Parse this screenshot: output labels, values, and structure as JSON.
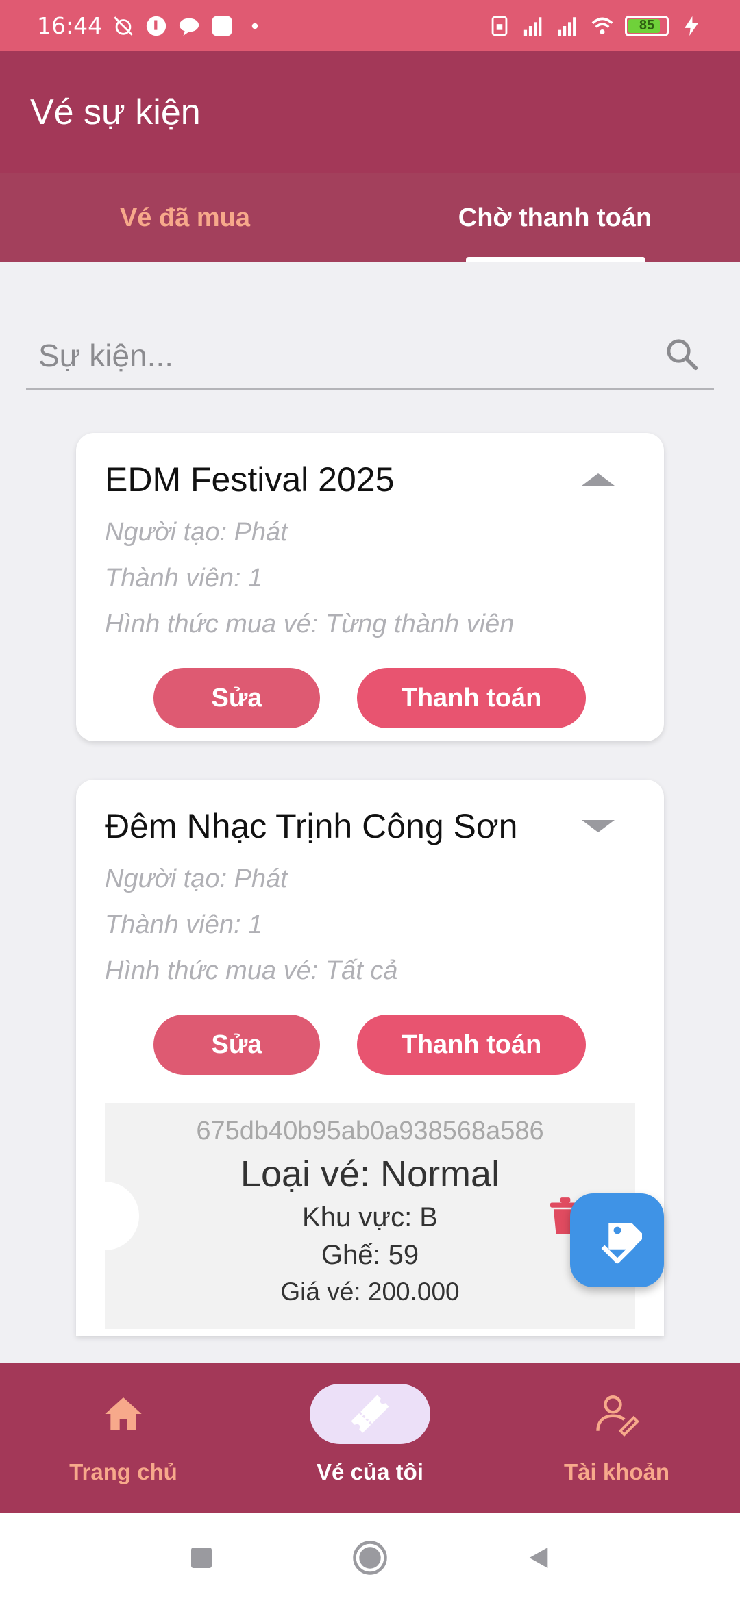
{
  "status_bar": {
    "time": "16:44",
    "battery": "85",
    "icons": [
      "alarm-off-icon",
      "messenger-icon",
      "chat-icon",
      "app-icon",
      "dot-icon",
      "sim-icon",
      "signal-icon",
      "signal-icon",
      "wifi-icon",
      "battery-icon",
      "charging-icon"
    ]
  },
  "app_bar": {
    "title": "Vé sự kiện"
  },
  "tabs": [
    {
      "label": "Vé đã mua",
      "active": false
    },
    {
      "label": "Chờ thanh toán",
      "active": true
    }
  ],
  "search": {
    "placeholder": "Sự kiện...",
    "value": ""
  },
  "cards": [
    {
      "title": "EDM Festival 2025",
      "creator": "Người tạo: Phát",
      "members": "Thành viên: 1",
      "purchase_type": "Hình thức mua vé: Từng thành viên",
      "edit_label": "Sửa",
      "pay_label": "Thanh toán",
      "expanded": false
    },
    {
      "title": "Đêm Nhạc Trịnh Công Sơn",
      "creator": "Người tạo: Phát",
      "members": "Thành viên: 1",
      "purchase_type": "Hình thức mua vé: Tất cả",
      "edit_label": "Sửa",
      "pay_label": "Thanh toán",
      "expanded": true,
      "ticket": {
        "id": "675db40b95ab0a938568a586",
        "type": "Loại vé: Normal",
        "area": "Khu vực: B",
        "seat": "Ghế: 59",
        "price": "Giá vé: 200.000"
      }
    }
  ],
  "bottom_nav": [
    {
      "label": "Trang chủ",
      "icon": "home-icon",
      "active": false
    },
    {
      "label": "Vé của tôi",
      "icon": "ticket-icon",
      "active": true
    },
    {
      "label": "Tài khoản",
      "icon": "account-icon",
      "active": false
    }
  ],
  "colors": {
    "status_bar": "#e05a72",
    "primary": "#a33858",
    "accent_text": "#f7a98b",
    "button": "#e85470",
    "fab": "#3f93e6",
    "background": "#f0f0f3"
  }
}
